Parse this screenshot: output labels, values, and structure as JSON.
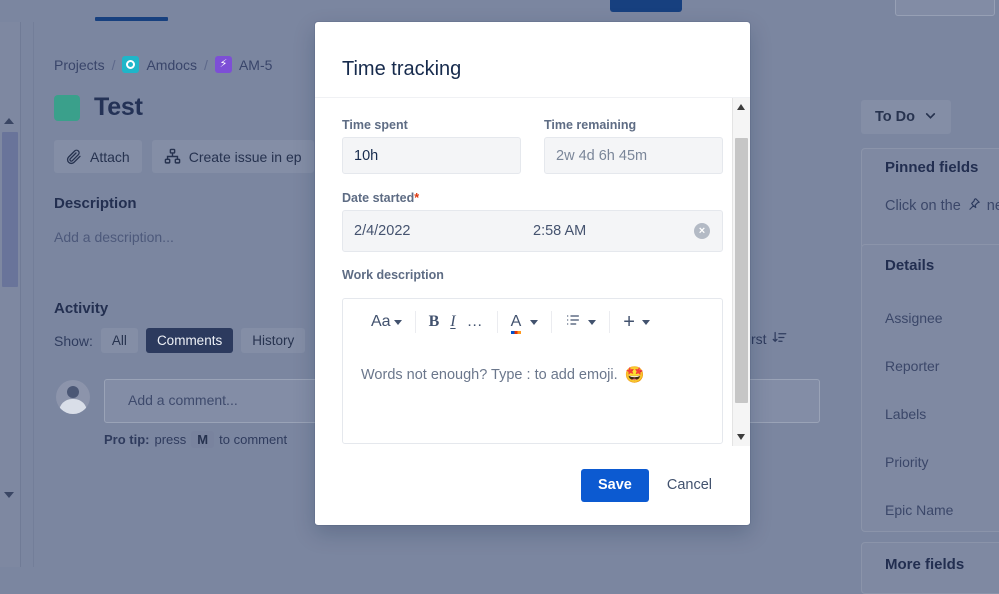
{
  "colors": {
    "accent_blue": "#0c5ad1",
    "nav_blue": "#17407f",
    "issue_type_green": "#3aa08b",
    "project_icon_teal": "#1fb6c9",
    "epic_icon_purple": "#7d4fd6",
    "required_red": "#de350b",
    "overlay": "#7b86a0"
  },
  "background_page": {
    "breadcrumb": {
      "projects_label": "Projects",
      "sep": "/",
      "project_label": "Amdocs",
      "issue_key": "AM-5"
    },
    "issue": {
      "title": "Test"
    },
    "actions": [
      {
        "label": "Attach",
        "icon": "paperclip-icon"
      },
      {
        "label": "Create issue in ep",
        "icon": "issue-hierarchy-icon"
      }
    ],
    "description": {
      "heading": "Description",
      "placeholder": "Add a description..."
    },
    "activity": {
      "heading": "Activity",
      "show_label": "Show:",
      "filters": [
        "All",
        "Comments",
        "History"
      ],
      "active_filter": "Comments",
      "sort_label": "first"
    },
    "comment": {
      "placeholder": "Add a comment...",
      "protip_prefix": "Pro tip:",
      "protip_mid": "press",
      "protip_key": "M",
      "protip_suffix": "to comment"
    },
    "sidebar": {
      "status": "To Do",
      "pinned": {
        "title": "Pinned fields",
        "description_pre": "Click on the",
        "description_post": "nex"
      },
      "details": {
        "title": "Details",
        "fields": [
          "Assignee",
          "Reporter",
          "Labels",
          "Priority",
          "Epic Name"
        ]
      },
      "more_fields_title": "More fields"
    }
  },
  "modal": {
    "title": "Time tracking",
    "time_spent": {
      "label": "Time spent",
      "value": "10h",
      "placeholder": "2w 4d 6h 45m"
    },
    "time_remaining": {
      "label": "Time remaining",
      "value": "",
      "placeholder": "2w 4d 6h 45m"
    },
    "date_started": {
      "label": "Date started",
      "required_marker": "*",
      "date": "2/4/2022",
      "time": "2:58 AM",
      "clear_glyph": "×"
    },
    "work_description": {
      "label": "Work description",
      "placeholder": "Words not enough? Type : to add emoji.",
      "emoji": "🤩",
      "toolbar": [
        {
          "name": "text-style",
          "glyph": "Aa",
          "has_chevron": true
        },
        {
          "name": "bold",
          "glyph": "B",
          "has_chevron": false
        },
        {
          "name": "italic",
          "glyph": "I",
          "has_chevron": false
        },
        {
          "name": "more-formatting",
          "glyph": "…",
          "has_chevron": false
        },
        {
          "name": "text-color",
          "glyph": "A",
          "has_chevron": true
        },
        {
          "name": "lists",
          "glyph": "≡",
          "has_chevron": true
        },
        {
          "name": "insert",
          "glyph": "+",
          "has_chevron": true
        }
      ]
    },
    "footer": {
      "save_label": "Save",
      "cancel_label": "Cancel"
    }
  }
}
